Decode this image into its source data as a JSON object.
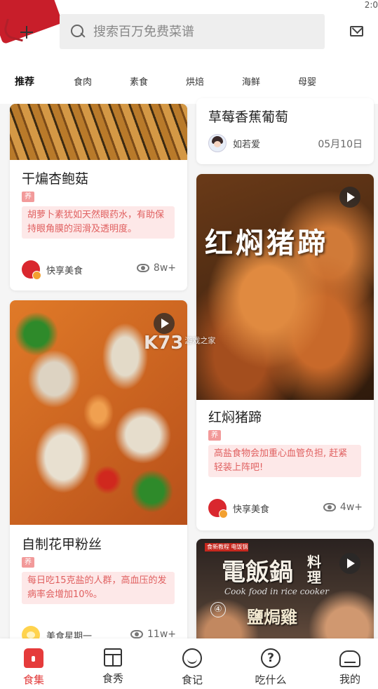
{
  "status": {
    "time": "2:0"
  },
  "search": {
    "placeholder": "搜索百万免费菜谱"
  },
  "tabs": [
    "推荐",
    "食肉",
    "素食",
    "烘焙",
    "海鲜",
    "母婴"
  ],
  "watermark": {
    "main": "K73",
    "sub": "游戏之家"
  },
  "cards": {
    "mushroom": {
      "title": "干煸杏鲍菇",
      "tag": "养",
      "tip": "胡萝卜素犹如天然眼药水，有助保持眼角膜的润滑及透明度。",
      "author": "快享美食",
      "views": "8w+"
    },
    "clam": {
      "title": "自制花甲粉丝",
      "tag": "养",
      "tip": "每日吃15克盐的人群，高血压的发病率会增加10%。",
      "author": "美食星期一",
      "views": "11w+"
    },
    "strawberry": {
      "title": "草莓香蕉葡萄",
      "author": "如若爱",
      "date": "05月10日"
    },
    "pork": {
      "overlay": "红焖猪蹄",
      "title": "红焖猪蹄",
      "tag": "养",
      "tip": "高盐食物会加重心血管负担, 赶紧轻装上阵吧!",
      "author": "快享美食",
      "views": "4w+"
    },
    "chicken": {
      "badge": "食新教程 电饭锅",
      "title": "電飯鍋",
      "title_small": "料理",
      "en": "Cook food in rice cooker",
      "num": "④",
      "subtitle": "鹽焗雞"
    }
  },
  "nav": [
    "食集",
    "食秀",
    "食记",
    "吃什么",
    "我的"
  ]
}
